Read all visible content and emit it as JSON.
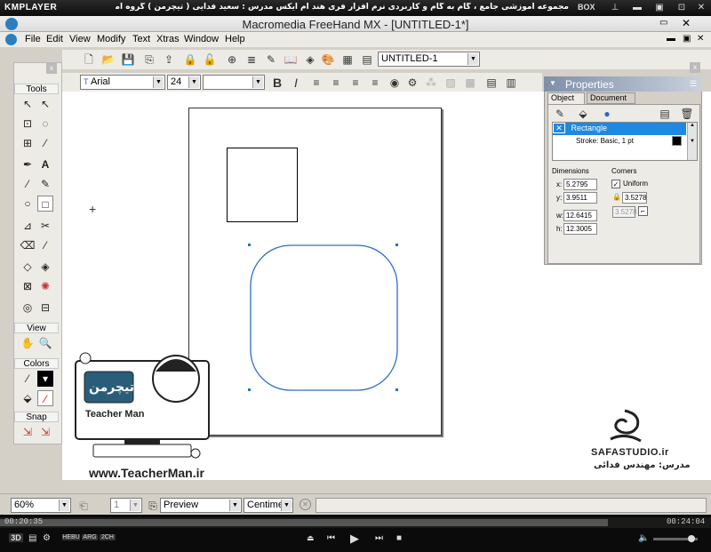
{
  "kmplayer": {
    "logo": "KMPLAYER",
    "title": "مجموعه آموزشی جامع ، گام به گام و کاربردی نرم افزار فری هند ام ایکس   مدرس : سعید فدایی ( تیچرمن ) گروه آموزشی پادشاه گرافیست ها",
    "box_label": "BOX",
    "time_current": "00:20:35",
    "time_total": "00:24:04",
    "progress": 0.855,
    "bottom_labels": [
      "3D",
      "HEBU",
      "ARG",
      "2CH"
    ]
  },
  "app": {
    "title": "Macromedia FreeHand MX - [UNTITLED-1*]",
    "menu": [
      "File",
      "Edit",
      "View",
      "Modify",
      "Text",
      "Xtras",
      "Window",
      "Help"
    ],
    "document_selector": "UNTITLED-1",
    "font_name": "Arial",
    "font_size": "24",
    "style_value": ""
  },
  "tools_panel": {
    "title": "Tools",
    "sections": {
      "view": "View",
      "colors": "Colors",
      "snap": "Snap"
    }
  },
  "properties": {
    "title": "Properties",
    "tabs": [
      "Object",
      "Document"
    ],
    "list": [
      "Rectangle",
      "Stroke: Basic, 1 pt"
    ],
    "dimensions_label": "Dimensions",
    "corners_label": "Corners",
    "x_label": "x:",
    "y_label": "y:",
    "w_label": "w:",
    "h_label": "h:",
    "x": "5.2795",
    "y": "3.9511",
    "w": "12.6415",
    "h": "12.3005",
    "uniform_label": "Uniform",
    "uniform_checked": true,
    "corner_value": "3.5278",
    "corner_value2": "3.5278"
  },
  "status_bar": {
    "zoom": "60%",
    "page": "1",
    "view_mode": "Preview",
    "units": "Centimeters"
  },
  "overlay": {
    "teacher_url": "www.TeacherMan.ir",
    "teacher_logo_text": "تیچرمن",
    "teacher_logo_sub": "Teacher Man",
    "studio_name": "SAFASTUDIO.ir",
    "studio_teacher": "مدرس: مهندس فدائی"
  },
  "colors": {
    "selection_blue": "#1e88e5",
    "stroke_blue": "#2a6fc2"
  }
}
